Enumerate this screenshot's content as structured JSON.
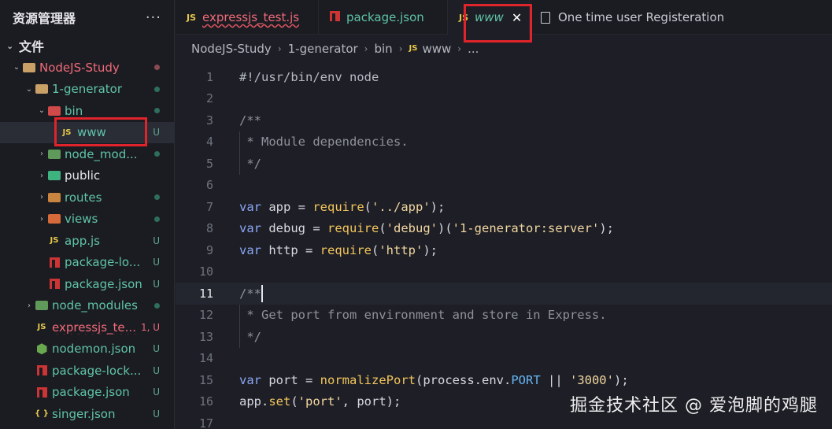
{
  "sidebar": {
    "title": "资源管理器",
    "more": "···",
    "section": "文件",
    "items": [
      {
        "label": "NodeJS-Study",
        "status": "dot-red"
      },
      {
        "label": "1-generator",
        "status": "dot-green"
      },
      {
        "label": "bin",
        "status": "dot-green"
      },
      {
        "label": "www",
        "status": "U"
      },
      {
        "label": "node_mod...",
        "status": "dot-green"
      },
      {
        "label": "public",
        "status": ""
      },
      {
        "label": "routes",
        "status": "dot-green"
      },
      {
        "label": "views",
        "status": "dot-green"
      },
      {
        "label": "app.js",
        "status": "U"
      },
      {
        "label": "package-lo...",
        "status": "U"
      },
      {
        "label": "package.json",
        "status": "U"
      },
      {
        "label": "node_modules",
        "status": "dot-green"
      },
      {
        "label": "expressjs_te...",
        "status": "1, U"
      },
      {
        "label": "nodemon.json",
        "status": "U"
      },
      {
        "label": "package-lock...",
        "status": "U"
      },
      {
        "label": "package.json",
        "status": "U"
      },
      {
        "label": "singer.json",
        "status": "U"
      }
    ]
  },
  "tabs": [
    {
      "label": "expressjs_test.js",
      "icon": "js-icon"
    },
    {
      "label": "package.json",
      "icon": "npm-icon"
    },
    {
      "label": "www",
      "icon": "js-icon"
    },
    {
      "label": "One time user Registeration",
      "icon": "file-icon"
    }
  ],
  "icons": {
    "js": "JS",
    "close": "✕",
    "braces": "{ }"
  },
  "breadcrumb": [
    "NodeJS-Study",
    "1-generator",
    "bin",
    "www",
    "..."
  ],
  "editor": {
    "line_numbers": [
      "1",
      "2",
      "3",
      "4",
      "5",
      "6",
      "7",
      "8",
      "9",
      "10",
      "11",
      "12",
      "13",
      "14",
      "15",
      "16",
      "17"
    ],
    "current_line": "11"
  },
  "code": {
    "l1": "#!/usr/bin/env node",
    "l3": "/**",
    "l4": " * Module dependencies.",
    "l5": " */",
    "l7": {
      "var": "var",
      "name": " app ",
      "eq": "= ",
      "fn": "require",
      "open": "(",
      "str": "'../app'",
      "close": ");"
    },
    "l8": {
      "var": "var",
      "name": " debug ",
      "eq": "= ",
      "fn": "require",
      "open": "(",
      "str": "'debug'",
      "mid": ")(",
      "str2": "'1-generator:server'",
      "close": ");"
    },
    "l9": {
      "var": "var",
      "name": " http ",
      "eq": "= ",
      "fn": "require",
      "open": "(",
      "str": "'http'",
      "close": ");"
    },
    "l11": "/**",
    "l12": " * Get port from environment and store in Express.",
    "l13": " */",
    "l15": {
      "var": "var",
      "name": " port ",
      "eq": "= ",
      "fn": "normalizePort",
      "open": "(process.env.",
      "prop": "PORT",
      "mid": " || ",
      "str": "'3000'",
      "close": ");"
    },
    "l16": {
      "obj": "app.",
      "fn": "set",
      "open": "(",
      "str": "'port'",
      "close": ", port);"
    }
  },
  "watermark": "掘金技术社区 @ 爱泡脚的鸡腿",
  "colors": {
    "accent_red": "#e0242b",
    "keyword": "#8aa6f5",
    "function": "#f2c55c",
    "string": "#f1d6a0"
  }
}
